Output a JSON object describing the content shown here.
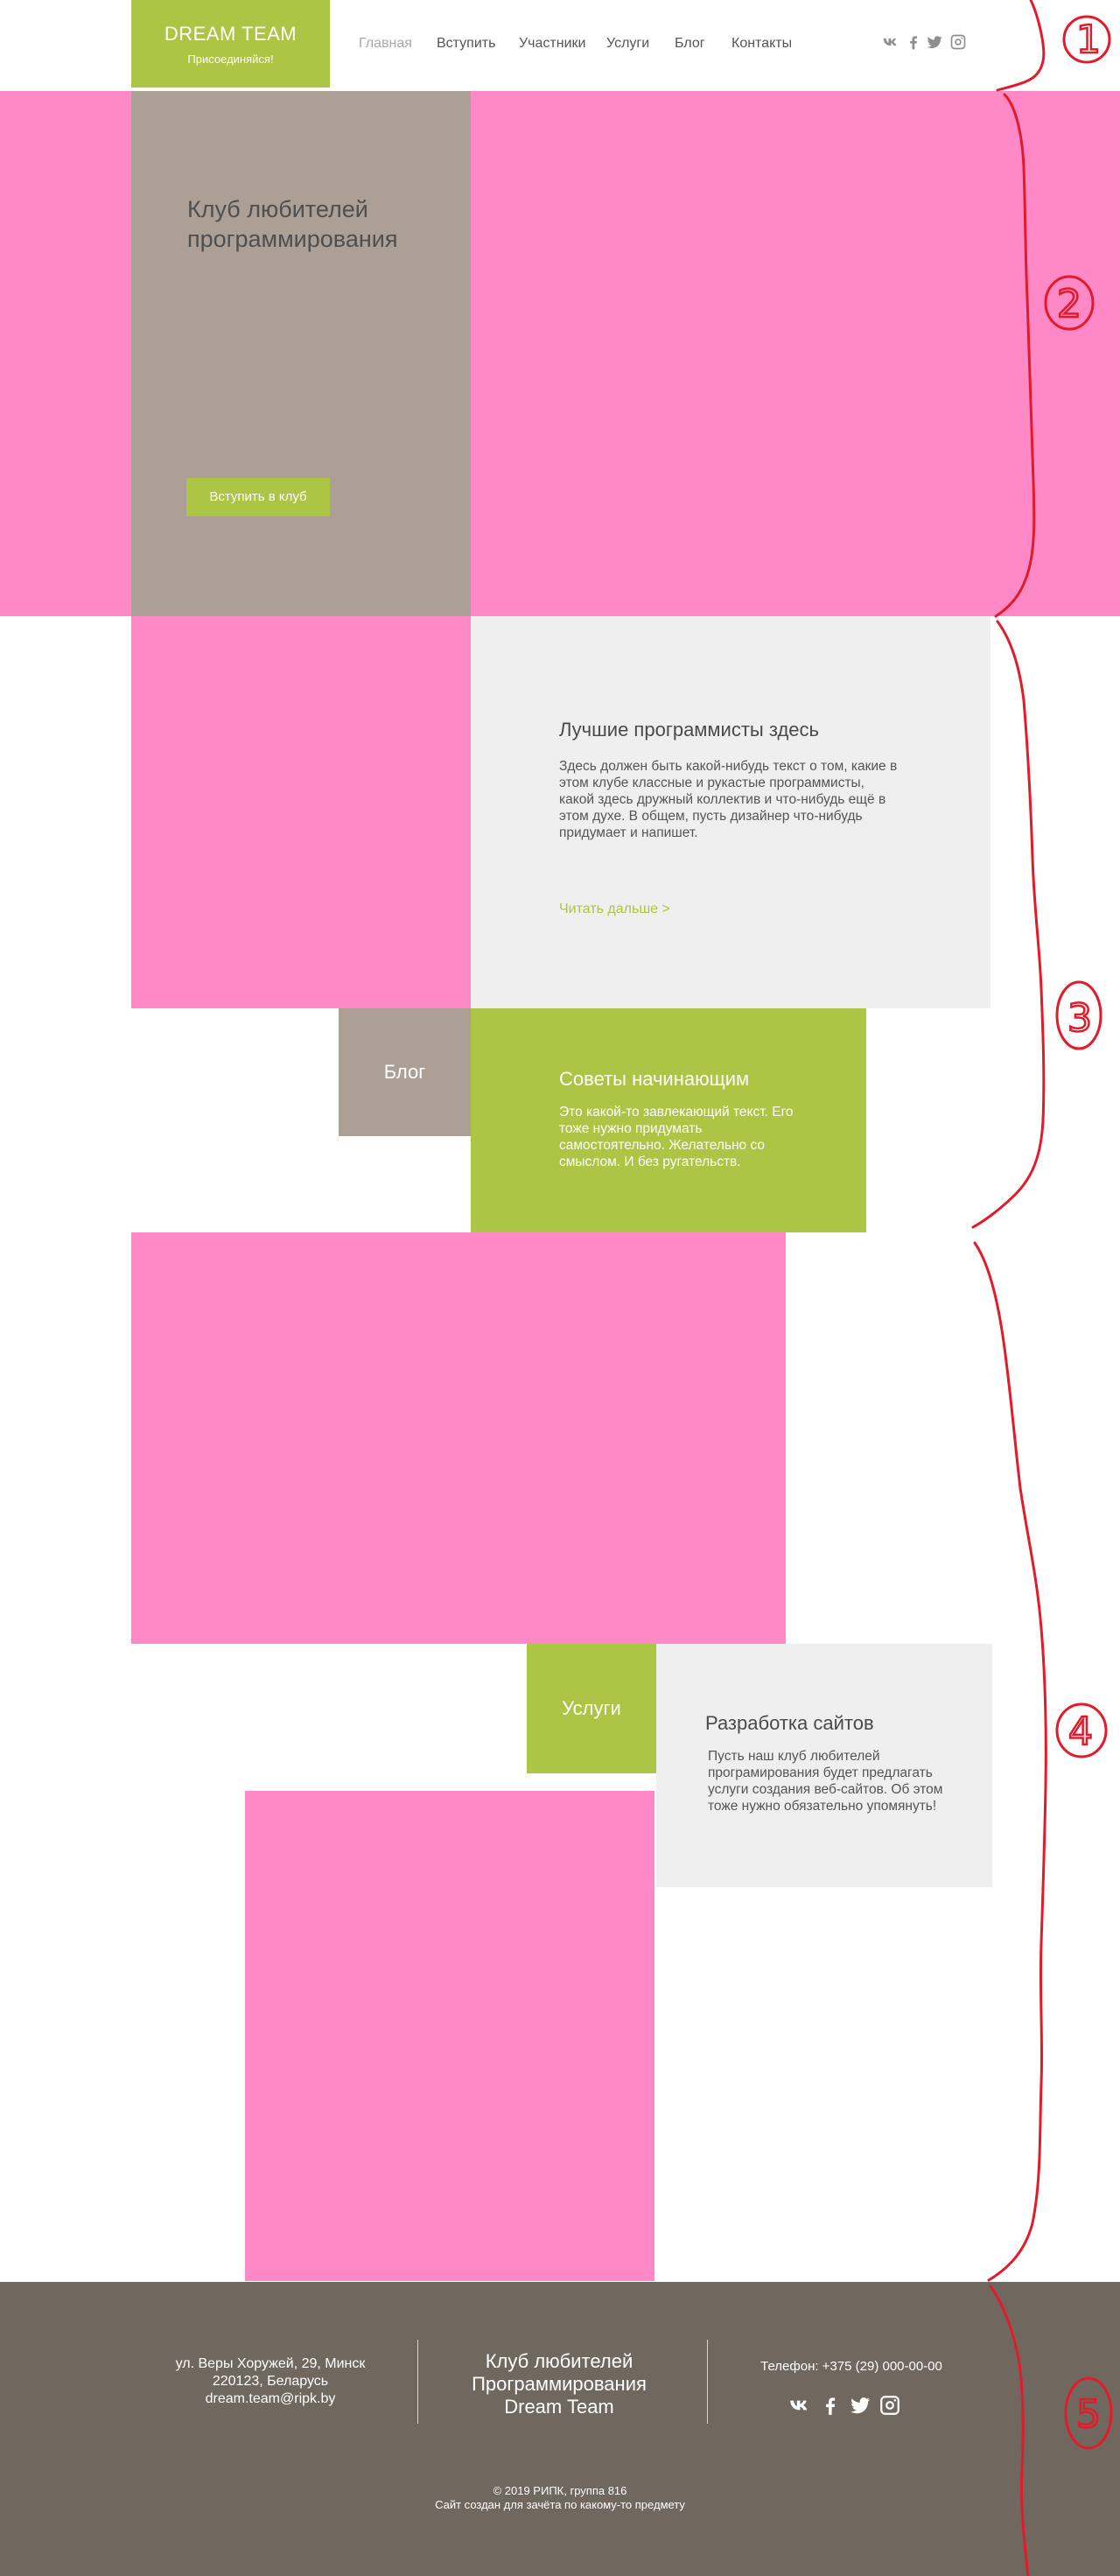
{
  "header": {
    "logo_title": "DREAM TEAM",
    "logo_subtitle": "Присоединяйся!",
    "nav": [
      {
        "label": "Главная",
        "active": true
      },
      {
        "label": "Вступить",
        "active": false
      },
      {
        "label": "Участники",
        "active": false
      },
      {
        "label": "Услуги",
        "active": false
      },
      {
        "label": "Блог",
        "active": false
      },
      {
        "label": "Контакты",
        "active": false
      }
    ],
    "social_icons": [
      "vk-icon",
      "facebook-icon",
      "twitter-icon",
      "instagram-icon"
    ]
  },
  "hero": {
    "title": "Клуб любителей программирования",
    "button_label": "Вступить в клуб"
  },
  "best": {
    "title": "Лучшие программисты здесь",
    "text": "Здесь должен быть какой-нибудь текст о том, какие в этом клубе классные и рукастые программисты, какой здесь дружный коллектив и что-нибудь ещё в этом духе. В общем, пусть дизайнер что-нибудь придумает и напишет.",
    "link": "Читать дальше >"
  },
  "blog": {
    "label": "Блог",
    "title": "Советы начинающим",
    "text": "Это какой-то завлекающий текст. Его тоже нужно придумать самостоятельно. Желательно со смыслом. И без ругательств."
  },
  "services": {
    "label": "Услуги",
    "title": "Разработка сайтов",
    "text": "Пусть наш клуб любителей програмирования будет предлагать услуги создания веб-сайтов. Об этом тоже нужно обязательно упомянуть!"
  },
  "footer": {
    "address_line1": "ул. Веры Хоружей, 29, Минск",
    "address_line2": "220123, Беларусь",
    "email": "dream.team@ripk.by",
    "club_line1": "Клуб любителей",
    "club_line2": "Программирования",
    "club_line3": "Dream Team",
    "phone": "Телефон: +375 (29) 000-00-00",
    "copyright": "© 2019 РИПК, группа 816",
    "note": "Сайт создан для зачёта по какому-то предмету"
  },
  "annotations": {
    "labels": [
      "1",
      "2",
      "3",
      "4",
      "5"
    ],
    "color": "#e21b2b"
  },
  "colors": {
    "accent_green": "#acc544",
    "placeholder_pink": "#ff88c6",
    "taupe": "#ab9f96",
    "light_gray": "#efefef",
    "footer_brown": "#70675f"
  }
}
